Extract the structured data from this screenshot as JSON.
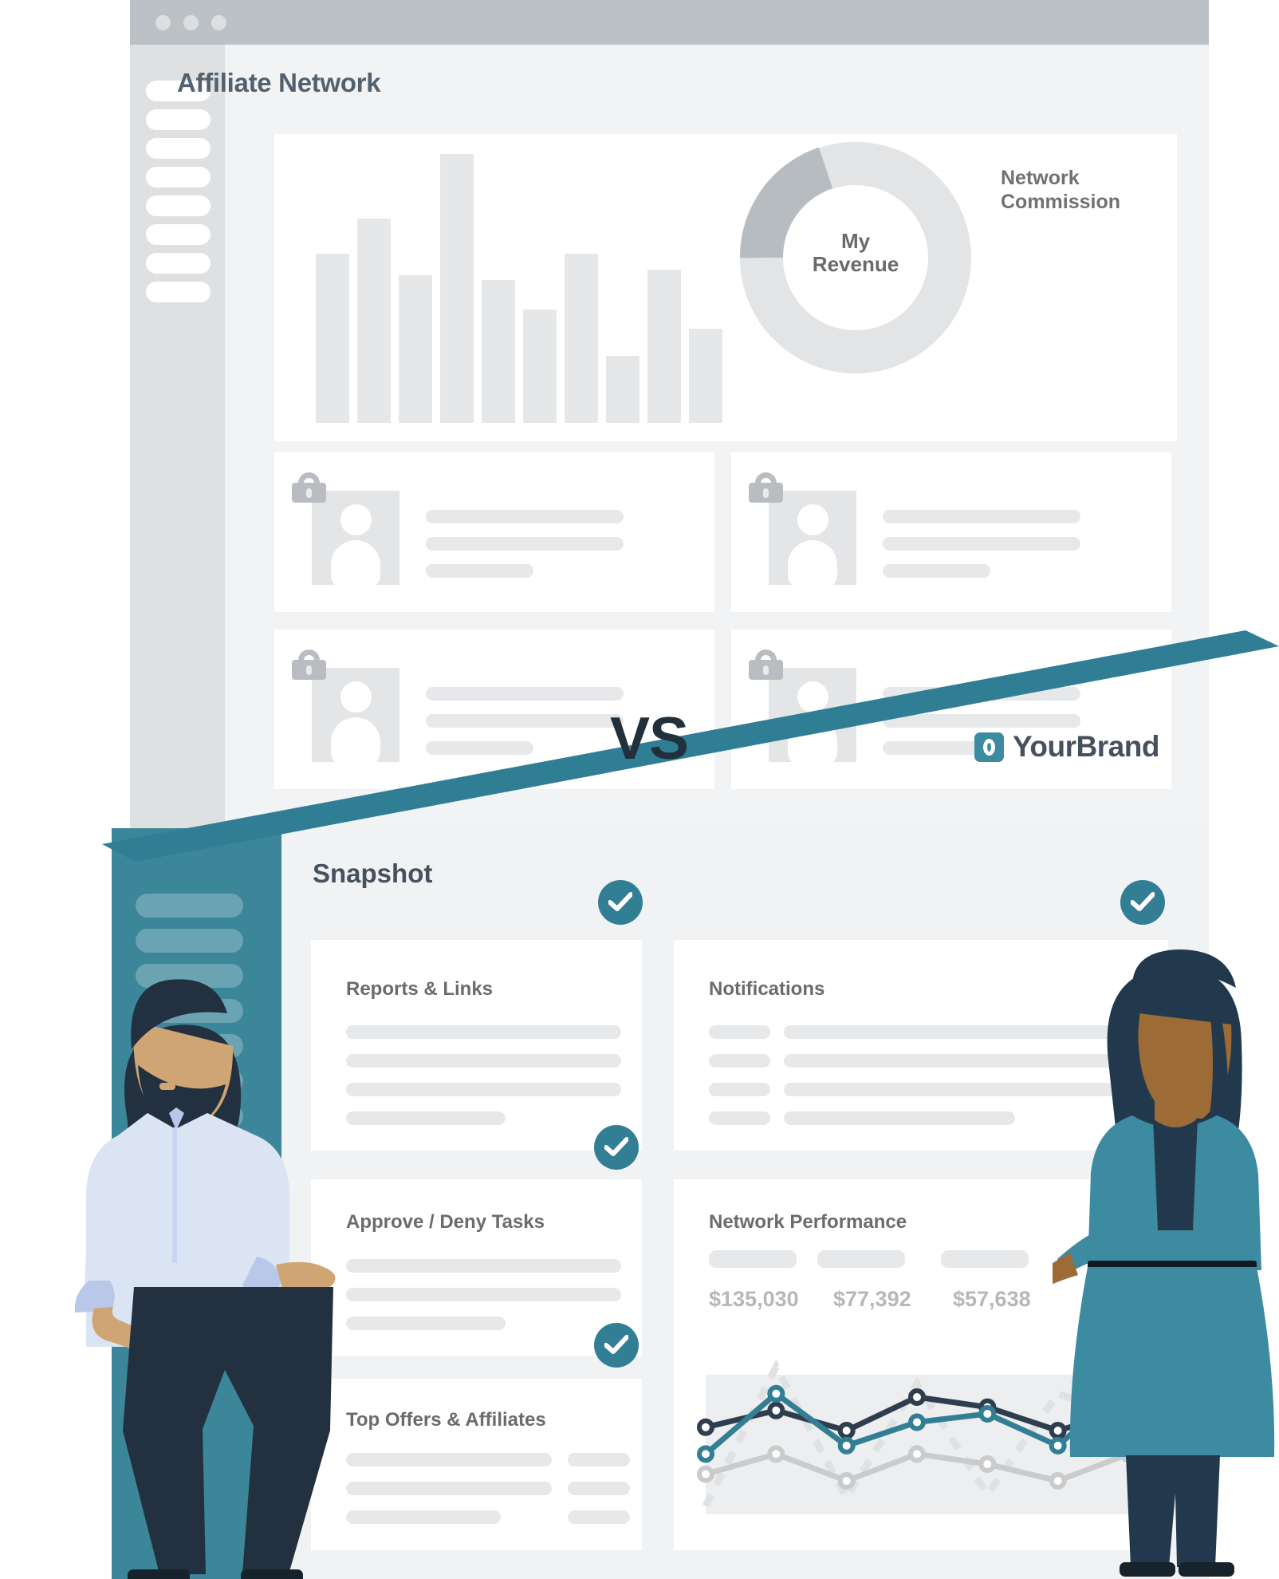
{
  "top_window": {
    "title": "Affiliate Network",
    "traffic_lights": [
      "close-dot",
      "minimize-dot",
      "maximize-dot"
    ],
    "sidebar_item_count": 8,
    "donut": {
      "center_label_line1": "My",
      "center_label_line2": "Revenue",
      "outer_label_line1": "Network",
      "outer_label_line2": "Commission"
    },
    "locked_cards": [
      {
        "name": "locked-affiliate-card-1",
        "line_widths": [
          248,
          248,
          135
        ]
      },
      {
        "name": "locked-affiliate-card-2",
        "line_widths": [
          248,
          248,
          135
        ]
      },
      {
        "name": "locked-affiliate-card-3",
        "line_widths": [
          248,
          248,
          135
        ]
      },
      {
        "name": "locked-affiliate-card-4",
        "line_widths": [
          248,
          248,
          135
        ]
      }
    ]
  },
  "divider": {
    "vs_label": "VS"
  },
  "brand": {
    "name": "YourBrand",
    "logo_icon": "ring-square-icon",
    "accent": "#3d8ba0"
  },
  "bottom_window": {
    "title": "Snapshot",
    "sidebar_item_count": 9,
    "cards": [
      {
        "title": "Reports & Links",
        "checked": true
      },
      {
        "title": "Notifications",
        "checked": true
      },
      {
        "title": "Approve / Deny Tasks",
        "checked": true
      },
      {
        "title": "Network Performance",
        "checked": false
      },
      {
        "title": "Top Offers & Affiliates",
        "checked": true
      }
    ],
    "network_performance": {
      "values": [
        "$135,030",
        "$77,392",
        "$57,638"
      ]
    }
  },
  "colors": {
    "teal": "#327f95",
    "teal_dark": "#3c8699",
    "navy": "#2f3e4f",
    "slate": "#46505e",
    "grey_bar": "#e6e7e8",
    "page_bg": "#f0f2f3"
  },
  "chart_data": [
    {
      "type": "bar",
      "title": "Affiliate Network revenue bars",
      "categories": [
        "1",
        "2",
        "3",
        "4",
        "5",
        "6",
        "7",
        "8",
        "9",
        "10"
      ],
      "values": [
        63,
        76,
        55,
        100,
        53,
        42,
        63,
        25,
        57,
        35
      ],
      "ylim": [
        0,
        100
      ],
      "xlabel": "",
      "ylabel": "",
      "grid": false,
      "legend": "none"
    },
    {
      "type": "pie",
      "title": "Revenue split",
      "labels": [
        "My Revenue",
        "Network Commission"
      ],
      "values": [
        80,
        20
      ],
      "colors": [
        "#e3e4e5",
        "#b6bcc0"
      ],
      "legend": "labels on chart"
    },
    {
      "type": "line",
      "title": "Network Performance",
      "x": [
        "1",
        "2",
        "3",
        "4",
        "5",
        "6",
        "7"
      ],
      "series": [
        {
          "name": "series-navy",
          "values": [
            52,
            62,
            50,
            70,
            64,
            50,
            62
          ],
          "color": "#2f3e4f"
        },
        {
          "name": "series-teal",
          "values": [
            36,
            72,
            41,
            55,
            60,
            41,
            78
          ],
          "color": "#327f95"
        },
        {
          "name": "series-grey",
          "values": [
            24,
            36,
            20,
            36,
            30,
            20,
            36
          ],
          "color": "#c9cbcd"
        },
        {
          "name": "series-dashed",
          "values": [
            5,
            88,
            10,
            78,
            12,
            72,
            58
          ],
          "color": "#dfe1e3"
        }
      ],
      "ylim": [
        0,
        100
      ],
      "xlabel": "",
      "ylabel": "",
      "grid": false,
      "legend": "none"
    }
  ]
}
